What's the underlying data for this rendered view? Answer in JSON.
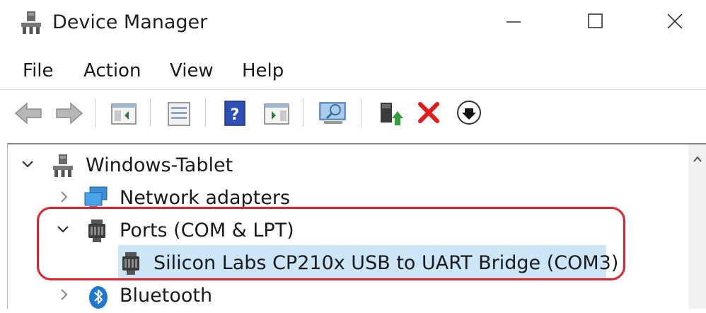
{
  "window": {
    "title": "Device Manager",
    "icon": "device-manager-icon",
    "controls": [
      "minimize-icon",
      "maximize-icon",
      "close-icon"
    ]
  },
  "menu": {
    "items": [
      {
        "label": "File"
      },
      {
        "label": "Action"
      },
      {
        "label": "View"
      },
      {
        "label": "Help"
      }
    ]
  },
  "toolbar": {
    "buttons": [
      {
        "icon": "back-arrow-icon"
      },
      {
        "icon": "forward-arrow-icon"
      },
      {
        "icon": "show-hide-console-tree-icon"
      },
      {
        "icon": "properties-icon"
      },
      {
        "icon": "help-icon"
      },
      {
        "icon": "action-pane-icon"
      },
      {
        "icon": "scan-hardware-icon"
      },
      {
        "icon": "update-driver-icon"
      },
      {
        "icon": "uninstall-device-icon"
      },
      {
        "icon": "disable-device-icon"
      }
    ]
  },
  "tree": {
    "root": {
      "label": "Windows-Tablet",
      "expanded": true,
      "icon": "computer-icon"
    },
    "categories": [
      {
        "label": "Network adapters",
        "expanded": false,
        "icon": "network-adapter-icon"
      },
      {
        "label": "Ports (COM & LPT)",
        "expanded": true,
        "icon": "port-icon",
        "children": [
          {
            "label": "Silicon Labs CP210x USB to UART Bridge (COM3)",
            "icon": "port-icon",
            "selected": true
          }
        ]
      },
      {
        "label": "Bluetooth",
        "expanded": false,
        "icon": "bluetooth-icon"
      }
    ]
  },
  "colors": {
    "selection": "#cde6f7",
    "highlight_border": "#e0202a",
    "delete_red": "#e21b1b"
  }
}
